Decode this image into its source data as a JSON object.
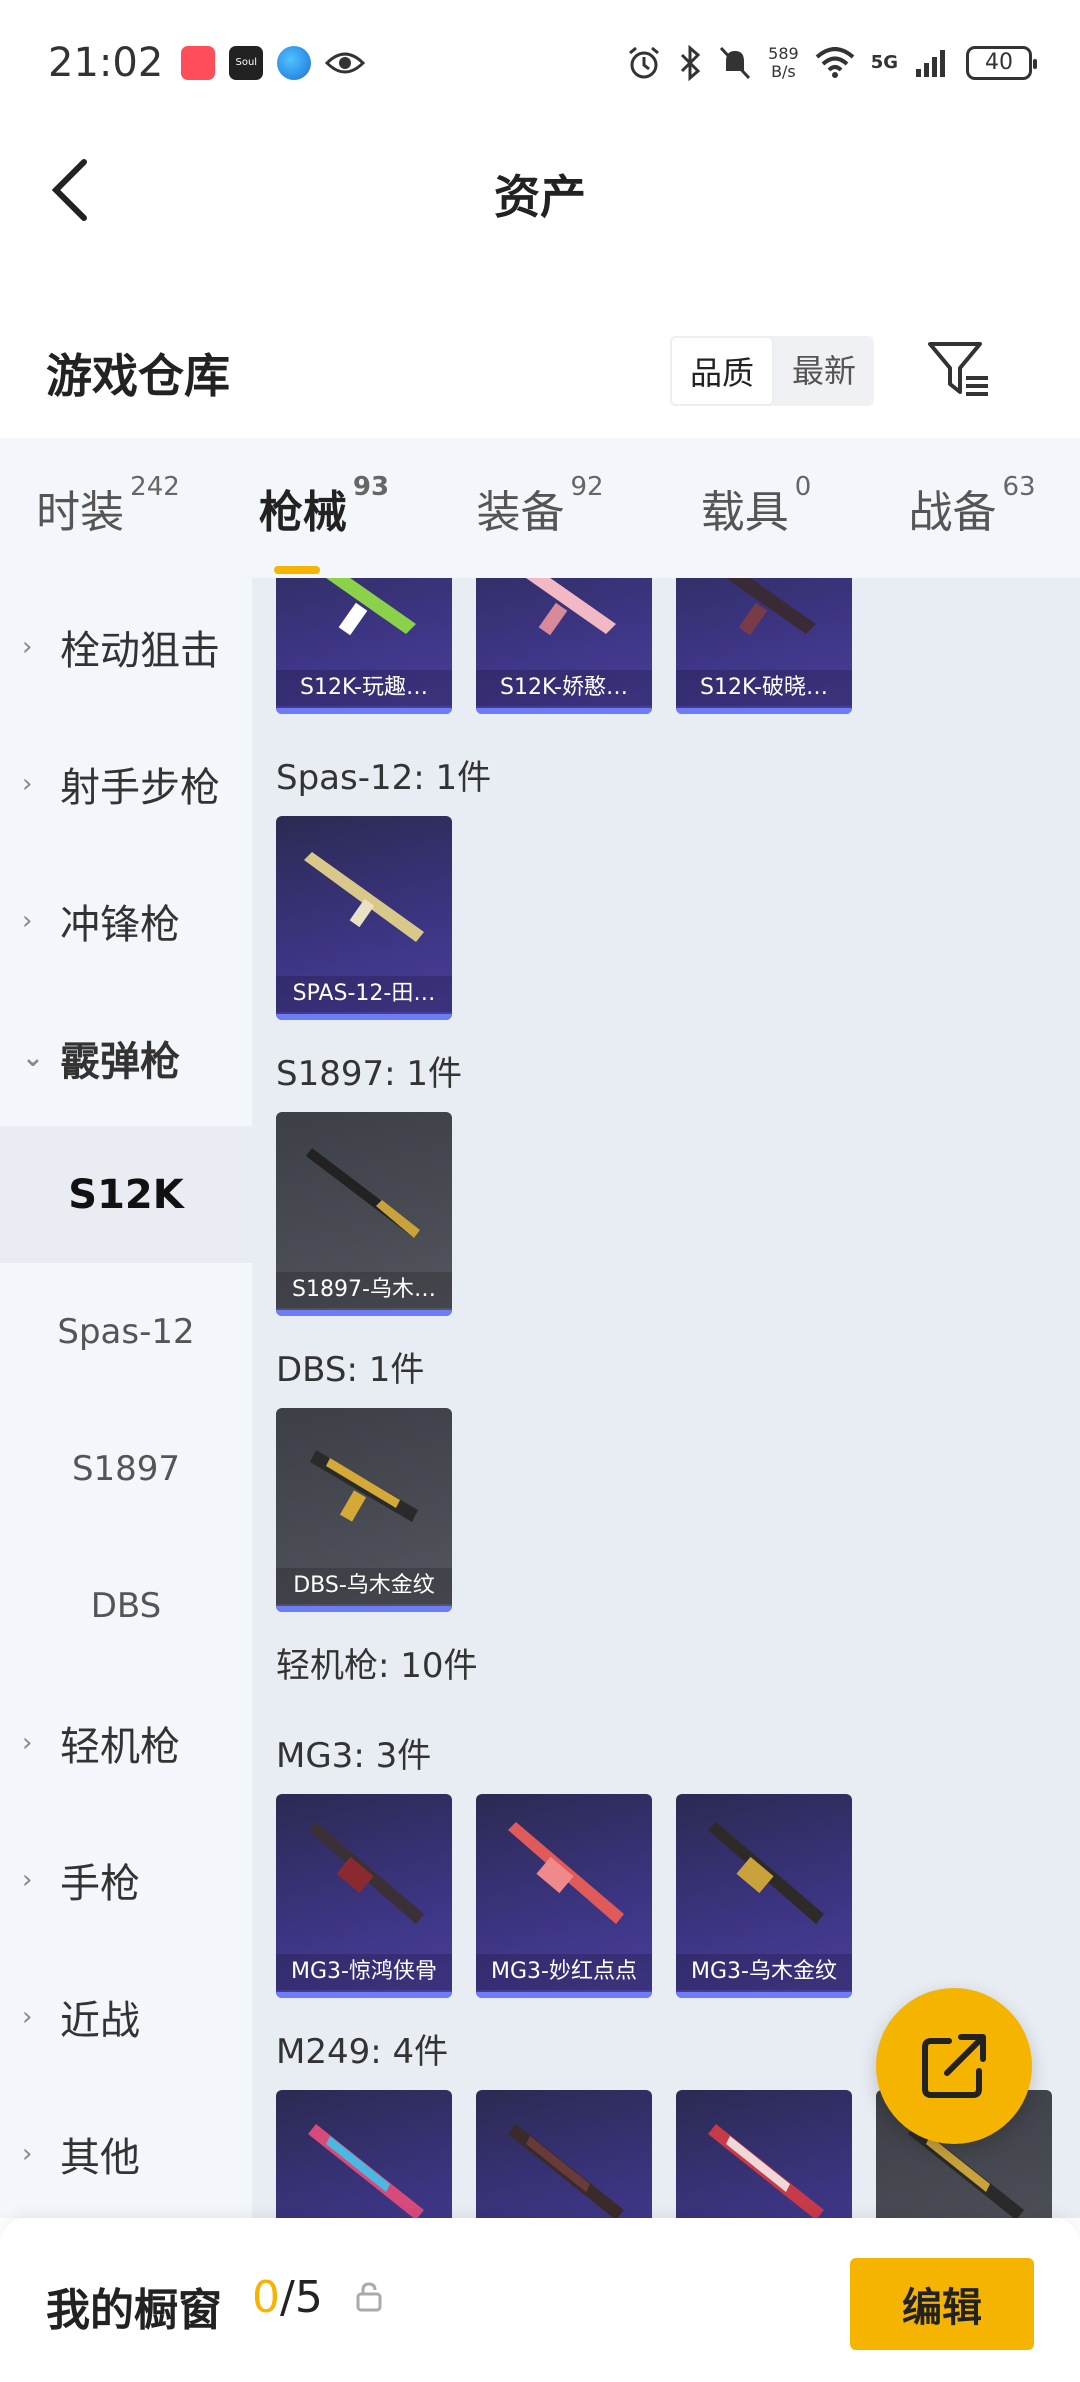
{
  "status_bar": {
    "time": "21:02",
    "speed_value": "589",
    "speed_unit": "B/s",
    "network": "5G",
    "battery": "40"
  },
  "header": {
    "title": "资产",
    "back_icon": "chevron-left-icon"
  },
  "warehouse": {
    "title": "游戏仓库",
    "sort_options": [
      "品质",
      "最新"
    ],
    "active_sort": "品质"
  },
  "tabs": [
    {
      "label": "时装",
      "count": "242"
    },
    {
      "label": "枪械",
      "count": "93"
    },
    {
      "label": "装备",
      "count": "92"
    },
    {
      "label": "载具",
      "count": "0"
    },
    {
      "label": "战备",
      "count": "63"
    }
  ],
  "active_tab": "枪械",
  "sidebar": {
    "items": [
      {
        "label": "栓动狙击"
      },
      {
        "label": "射手步枪"
      },
      {
        "label": "冲锋枪"
      },
      {
        "label": "霰弹枪"
      },
      {
        "label": "S12K"
      },
      {
        "label": "Spas-12"
      },
      {
        "label": "S1897"
      },
      {
        "label": "DBS"
      },
      {
        "label": "轻机枪"
      },
      {
        "label": "手枪"
      },
      {
        "label": "近战"
      },
      {
        "label": "其他"
      }
    ],
    "selected": "S12K",
    "expanded": "霰弹枪"
  },
  "content": {
    "sections": [
      {
        "label": "",
        "items": [
          "S12K-玩趣…",
          "S12K-娇憨…",
          "S12K-破晓…"
        ]
      },
      {
        "label": "Spas-12: 1件",
        "items": [
          "SPAS-12-田…"
        ]
      },
      {
        "label": "S1897: 1件",
        "items": [
          "S1897-乌木…"
        ]
      },
      {
        "label": "DBS: 1件",
        "items": [
          "DBS-乌木金纹"
        ]
      },
      {
        "label": "轻机枪: 10件",
        "items": []
      },
      {
        "label": "MG3: 3件",
        "items": [
          "MG3-惊鸿侠骨",
          "MG3-妙红点点",
          "MG3-乌木金纹"
        ]
      },
      {
        "label": "M249: 4件",
        "items": [
          "",
          "",
          "",
          ""
        ]
      }
    ]
  },
  "bottom": {
    "label": "我的橱窗",
    "current": "0",
    "separator": "/",
    "max": "5",
    "edit": "编辑"
  },
  "colors": {
    "accent": "#f5b400",
    "card_purple": "#3b3480",
    "card_grey": "#4a4c55",
    "rarity_bar": "#6f7cf7"
  }
}
